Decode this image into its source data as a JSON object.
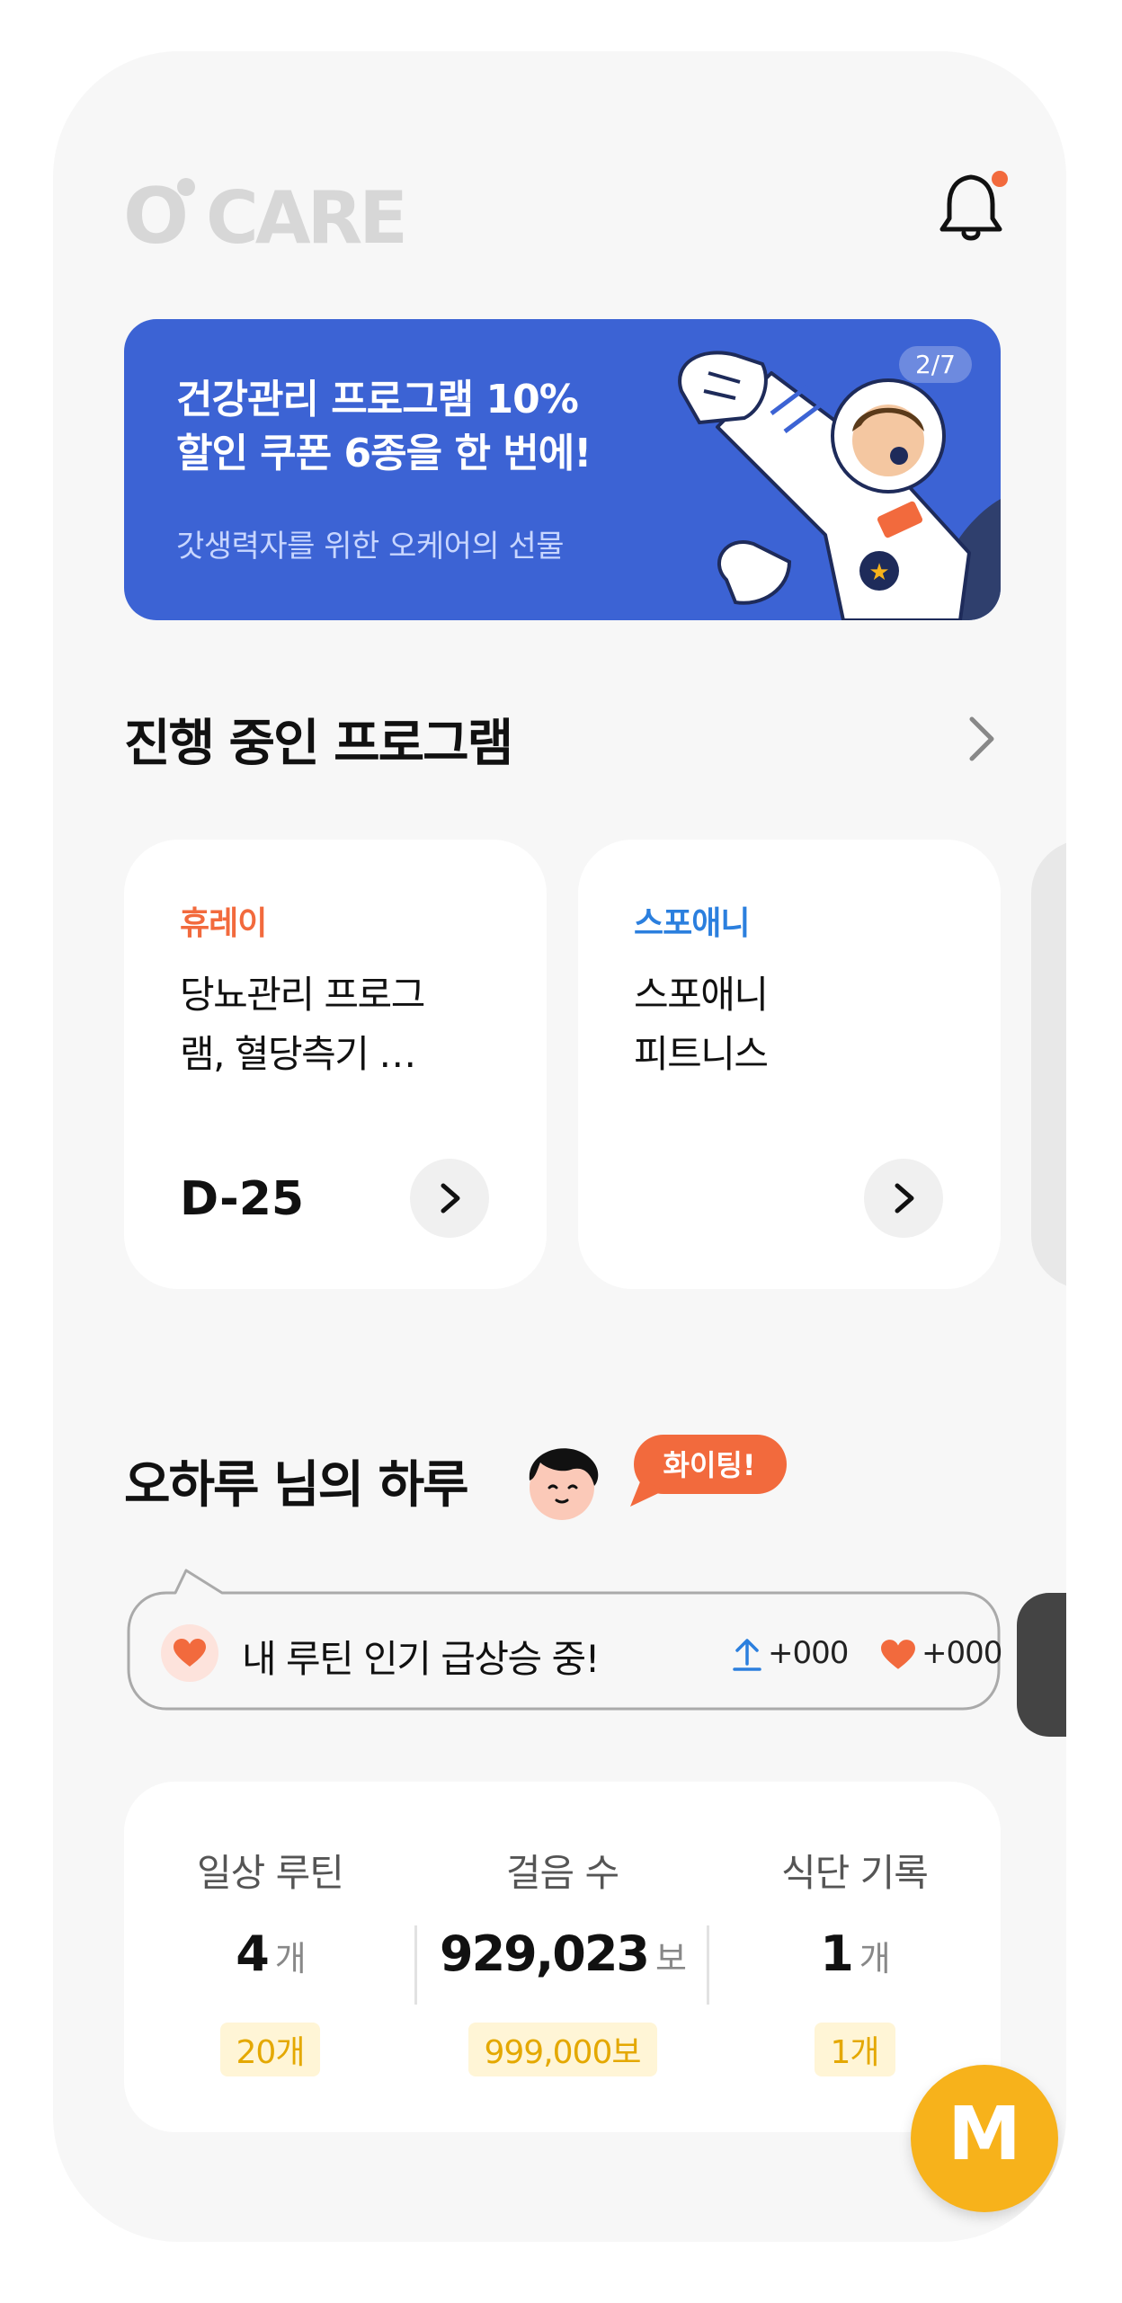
{
  "header": {
    "logo_text": "O'CARE",
    "bell_icon": "bell-icon",
    "notification_dot_color": "#f26a3d"
  },
  "banner": {
    "title": "건강관리 프로그램 10%\n할인 쿠폰 6종을 한 번에!",
    "subtitle": "갓생력자를 위한 오케어의 선물",
    "page_indicator": "2/7",
    "background_color": "#3c63d4"
  },
  "programs": {
    "section_title": "진행 중인 프로그램",
    "cards": [
      {
        "brand": "휴레이",
        "brand_color": "#f26a3d",
        "name": "당뇨관리 프로그\n램, 혈당측기 …",
        "dday": "D-25"
      },
      {
        "brand": "스포애니",
        "brand_color": "#2b7fde",
        "name": "스포애니\n피트니스",
        "dday": ""
      }
    ]
  },
  "day": {
    "title": "오하루 님의 하루",
    "cheer_badge": "화이팅!",
    "routine_message": "내 루틴 인기 급상승 중!",
    "share_count": "+000",
    "like_count": "+000"
  },
  "stats": [
    {
      "label": "일상 루틴",
      "value": "4",
      "unit": "개",
      "goal": "20개"
    },
    {
      "label": "걸음 수",
      "value": "929,023",
      "unit": "보",
      "goal": "999,000보"
    },
    {
      "label": "식단 기록",
      "value": "1",
      "unit": "개",
      "goal": "1개"
    }
  ],
  "fab": {
    "label": "M",
    "color": "#f7b21b"
  }
}
